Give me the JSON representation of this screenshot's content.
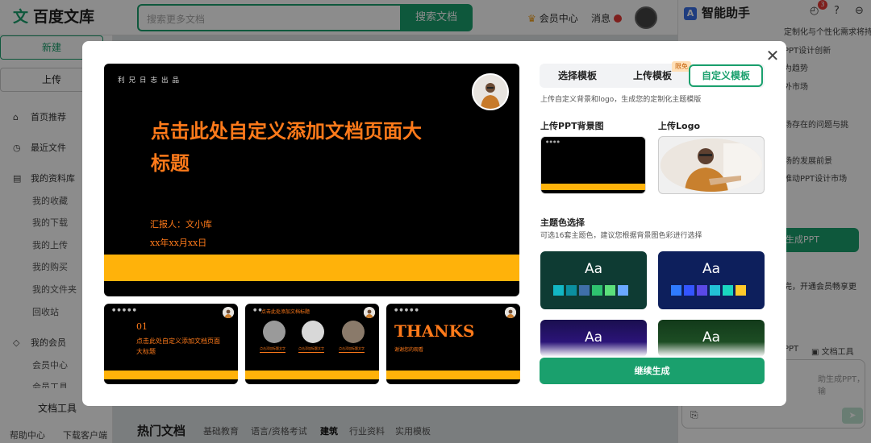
{
  "app": {
    "logo_mark": "文",
    "logo_text": "百度文库",
    "search_placeholder": "搜索更多文档",
    "search_button": "搜索文档",
    "member_center": "会员中心",
    "messages": "消息"
  },
  "sidebar": {
    "new_button": "新建",
    "upload_button": "上传",
    "items": [
      {
        "label": "首页推荐",
        "icon": "home-icon"
      },
      {
        "label": "最近文件",
        "icon": "clock-icon"
      },
      {
        "label": "我的资料库",
        "icon": "folder-icon"
      }
    ],
    "library_subitems": [
      "我的收藏",
      "我的下载",
      "我的上传",
      "我的购买",
      "我的文件夹",
      "回收站"
    ],
    "member_item": {
      "label": "我的会员",
      "icon": "diamond-icon"
    },
    "member_subitems": [
      "会员中心",
      "会员工具"
    ],
    "doc_tools": "文档工具",
    "help_center": "帮助中心",
    "download_client": "下载客户端"
  },
  "hot_docs": {
    "title": "热门文档",
    "tabs": [
      "基础教育",
      "语言/资格考试",
      "建筑",
      "行业资料",
      "实用模板"
    ],
    "active_tab": "建筑"
  },
  "assistant": {
    "title": "智能助手",
    "badge_count": "3",
    "lines": [
      "定制化与个性化需求将持续增长",
      "PPT设计创新",
      "为趋势",
      "外市场",
      "场存在的问题与挑",
      "场的发展前景",
      "推动PPT设计市场"
    ],
    "generate_label": "生成PPT",
    "member_text": "完，开通会员畅享更",
    "tool_ppt": "PPT",
    "tool_doc": "文档工具",
    "input_placeholder": "助生成PPT，输"
  },
  "modal": {
    "main_slide": {
      "header": "利兄日志出品",
      "title": "点击此处自定义添加文档页面大标题",
      "reporter": "汇报人：文小库",
      "date": "xx年xx月xx日"
    },
    "thumbs": [
      {
        "num": "01",
        "title": "点击此处自定义添加文档页面大标题"
      },
      {
        "title": "点击此处添加文档标题",
        "captions": [
          "点击添加标题文字",
          "点击添加标题文字",
          "点击添加标题文字"
        ]
      },
      {
        "thanks": "THANKS",
        "sub": "谢谢您的观看"
      }
    ],
    "tabs": [
      "选择模板",
      "上传模板",
      "自定义模板"
    ],
    "tag_limited": "限免",
    "desc": "上传自定义背景和logo，生成您的定制化主题模版",
    "upload_bg_label": "上传PPT背景图",
    "upload_logo_label": "上传Logo",
    "theme_title": "主题色选择",
    "theme_desc": "可选16套主题色，建议您根据背景图色彩进行选择",
    "theme_sample": "Aa",
    "themes": [
      {
        "bg": "#0e3b33",
        "swatches": [
          "#12b7c4",
          "#0b8fa0",
          "#3f6fa8",
          "#2ec26f",
          "#5be07a",
          "#6aa8ff"
        ]
      },
      {
        "bg": "#0d1f5c",
        "swatches": [
          "#2f7bff",
          "#3355ff",
          "#5a49e6",
          "#23c2d6",
          "#1ad6c0",
          "#ffc92a"
        ]
      },
      {
        "bg": "#1a0f4f",
        "swatches": []
      },
      {
        "bg": "#123a1a",
        "swatches": []
      }
    ],
    "continue_button": "继续生成"
  }
}
